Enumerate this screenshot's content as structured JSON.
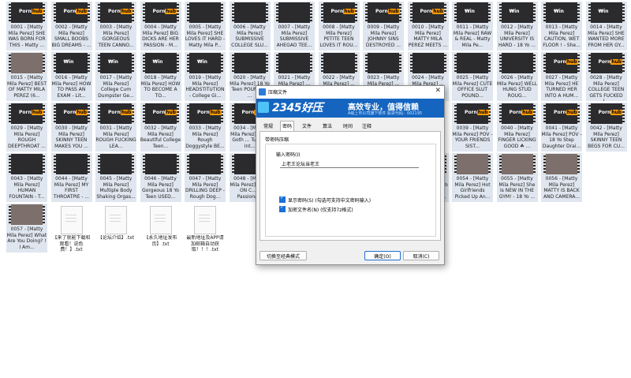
{
  "files": [
    {
      "name": "0001 - [Matty Mila Perez] SHE WAS BORN FOR THIS - Matty ...",
      "badge": "ph"
    },
    {
      "name": "0002 - [Matty Mila Perez] SMALL BOOBS BIG DREAMS - ...",
      "badge": "ph"
    },
    {
      "name": "0003 - [Matty Mila Perez] GORGEOUS TEEN CANNO...",
      "badge": "ph"
    },
    {
      "name": "0004 - [Matty Mila Perez] BIG DICKS ARE HER PASSION - M...",
      "badge": "ph"
    },
    {
      "name": "0005 - [Matty Mila Perez] SHE LOVES IT HARD - Matty Mila P...",
      "badge": "none"
    },
    {
      "name": "0006 - [Matty Mila Perez] SUBMISSIVE COLLEGE SLU...",
      "badge": "none"
    },
    {
      "name": "0007 - [Matty Mila Perez] SUBMISSIVE AHEGAO TEE...",
      "badge": "none"
    },
    {
      "name": "0008 - [Matty Mila Perez] PETITE TEEN LOVES IT ROU...",
      "badge": "ph"
    },
    {
      "name": "0009 - [Matty Mila Perez] JOHNNY SINS DESTROYED ...",
      "badge": "ph"
    },
    {
      "name": "0010 - [Matty Mila Perez] MATTY MILA PEREZ MEETS ...",
      "badge": "ph"
    },
    {
      "name": "0011 - [Matty Mila Perez] RAW & REAL - Matty Mila Pe...",
      "badge": "win"
    },
    {
      "name": "0012 - [Matty Mila Perez] UNIVERSITY IS HARD - 18 Yo ...",
      "badge": "win"
    },
    {
      "name": "0013 - [Matty Mila Perez] CAUTION, WET FLOOR ! - She...",
      "badge": "win"
    },
    {
      "name": "0014 - [Matty Mila Perez] SHE WANTED MORE FROM HER GY...",
      "badge": "win"
    },
    {
      "name": "0015 - [Matty Mila Perez] BEST OF MATTY MILA PEREZ (6...",
      "badge": "none",
      "light": true
    },
    {
      "name": "0016 - [Matty Mila Perez] HOW TO PASS AN EXAM - Lit...",
      "badge": "win"
    },
    {
      "name": "0017 - [Matty Mila Perez] College Cum Dumpster Ge...",
      "badge": "win"
    },
    {
      "name": "0018 - [Matty Mila Perez] HOW TO BECOME A TO...",
      "badge": "win"
    },
    {
      "name": "0019 - [Matty Mila Perez] HEADSTITUTION - College Gi...",
      "badge": "win"
    },
    {
      "name": "0020 - [Matty Mila Perez] 18 Yo Teen POUNDED ...",
      "badge": "none"
    },
    {
      "name": "0021 - [Matty Mila Perez] ...",
      "badge": "none"
    },
    {
      "name": "0022 - [Matty Mila Perez] ...",
      "badge": "none"
    },
    {
      "name": "0023 - [Matty Mila Perez] ...",
      "badge": "none"
    },
    {
      "name": "0024 - [Matty Mila Perez] ...",
      "badge": "none"
    },
    {
      "name": "0025 - [Matty Mila Perez] CUTE OFFICE SLUT POUND...",
      "badge": "none"
    },
    {
      "name": "0026 - [Matty Mila Perez] WELL HUNG STUD ROUG...",
      "badge": "none"
    },
    {
      "name": "0027 - [Matty Mila Perez] HE TURNED HER INTO A HUM...",
      "badge": "ph"
    },
    {
      "name": "0028 - [Matty Mila Perez] COLLEGE TEEN GETS FUCKED (...",
      "badge": "ph"
    },
    {
      "name": "0029 - [Matty Mila Perez] ROUGH DEEPTHROAT ...",
      "badge": "ph"
    },
    {
      "name": "0030 - [Matty Mila Perez] SKINNY TEEN MAKES YOU ...",
      "badge": "ph"
    },
    {
      "name": "0031 - [Matty Mila Perez] ROUGH FUCKING LEA...",
      "badge": "ph"
    },
    {
      "name": "0032 - [Matty Mila Perez] Beautiful College Teen...",
      "badge": "ph"
    },
    {
      "name": "0033 - [Matty Mila Perez] Rough Doggystyle BE...",
      "badge": "ph"
    },
    {
      "name": "0034 - [Matty Mila Perez] Cute Goth ... Turned Int...",
      "badge": "ph"
    },
    {
      "name": "",
      "badge": "none",
      "hidden": true
    },
    {
      "name": "",
      "badge": "none",
      "hidden": true
    },
    {
      "name": "",
      "badge": "none",
      "hidden": true
    },
    {
      "name": "",
      "badge": "none",
      "hidden": true
    },
    {
      "name": "0039 - [Matty Mila Perez] POV - YOUR FRIENDS SIST...",
      "badge": "ph"
    },
    {
      "name": "0040 - [Matty Mila Perez] FINGER LICKING GOOD ☘ ...",
      "badge": "ph"
    },
    {
      "name": "0041 - [Matty Mila Perez] POV - 18 Yo Step Daughter Drai...",
      "badge": "ph"
    },
    {
      "name": "0042 - [Matty Mila Perez] SKINNY TEEN BEGS FOR CU...",
      "badge": "ph"
    },
    {
      "name": "0043 - [Matty Mila Perez] HUMAN FOUNTAIN - T...",
      "badge": "none"
    },
    {
      "name": "0044 - [Matty Mila Perez] MY FIRST THROATPIE - ...",
      "badge": "none"
    },
    {
      "name": "0045 - [Matty Mila Perez] Multiple Body Shaking Orgas...",
      "badge": "none"
    },
    {
      "name": "0046 - [Matty Mila Perez] Gorgeous 18 Yo Teen USED...",
      "badge": "none"
    },
    {
      "name": "0047 - [Matty Mila Perez] DRILLING DEEP - Rough Dog...",
      "badge": "none"
    },
    {
      "name": "0048 - [Matty Mila Perez] HIGH ON C... - Passiona...",
      "badge": "none"
    },
    {
      "name": "",
      "badge": "none",
      "hidden": true
    },
    {
      "name": "",
      "badge": "none",
      "hidden": true
    },
    {
      "name": "",
      "badge": "none",
      "hidden": true
    },
    {
      "name": "0053 - [Matty Mila Perez] 18 Yo Teen Fucked HARD By A Bi...",
      "badge": "none",
      "light": true
    },
    {
      "name": "0054 - [Matty Mila Perez] Hot Girlfriends Picked Up An...",
      "badge": "none",
      "light": true
    },
    {
      "name": "0055 - [Matty Mila Perez] She Is NEW IN THE GYM! - 18 Yo ...",
      "badge": "none",
      "light": true
    },
    {
      "name": "0056 - [Matty Mila Perez] MATTY IS BACK AND CAMERA...",
      "badge": "none",
      "light": true
    },
    {
      "name": "",
      "badge": "none",
      "hidden": true
    },
    {
      "name": "0057 - [Matty Mila Perez] What Are You Doing? ! I Am...",
      "badge": "none",
      "light": true
    },
    {
      "name": "【来了就能下载和观看！说色费！】.txt",
      "badge": "txt"
    },
    {
      "name": "【论坛介绍】.txt",
      "badge": "txt"
    },
    {
      "name": "【永久地址发布页】.txt",
      "badge": "txt"
    },
    {
      "name": "最新地址及APP请加邮箱自动获取！！！.txt",
      "badge": "txt"
    }
  ],
  "badge_text": {
    "porn": "Porn",
    "hub": "hub",
    "win": "₩in"
  },
  "dialog": {
    "title": "压缩文件",
    "close": "✕",
    "banner_logo": "2345好压",
    "banner_slogan": "高效专业，值得信赖",
    "banner_sub": "A级上市公司旗下软件 股票代码：002195",
    "tabs": [
      "常规",
      "密码",
      "文件",
      "算法",
      "时间",
      "注释"
    ],
    "active_tab": 1,
    "panel_header": "带密码压缩",
    "pw_label": "输入密码(I)",
    "pw_value": "上老王论坛当老王",
    "chk_show": "显示密码(S)  (勾选可支持中文密码输入)",
    "chk_encrypt": "加密文件名(N)  (仅支持7z格式)",
    "btn_mode": "切换至经典模式",
    "btn_ok": "确定(O)",
    "btn_cancel": "取消(C)"
  }
}
